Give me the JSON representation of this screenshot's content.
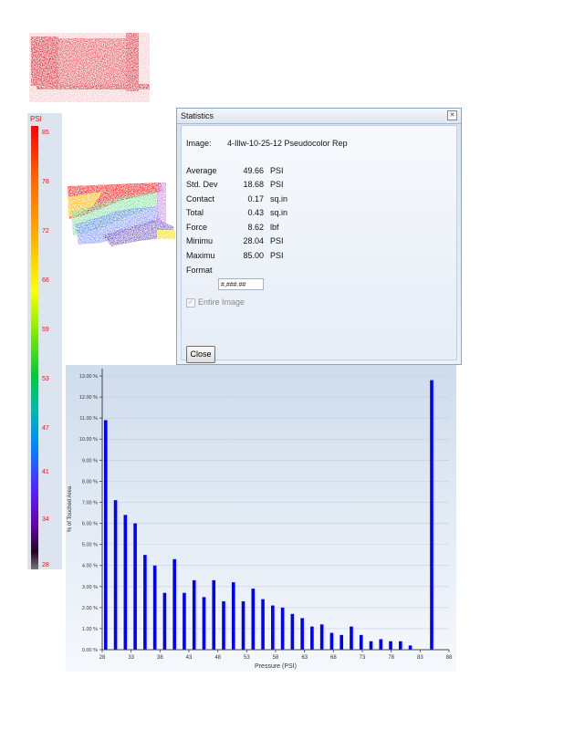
{
  "thumbnail": {
    "name": "pressure-thumbnail"
  },
  "scale": {
    "unit": "PSI",
    "ticks": [
      "85",
      "78",
      "72",
      "66",
      "59",
      "53",
      "47",
      "41",
      "34",
      "28"
    ]
  },
  "stats_window": {
    "title": "Statistics",
    "close_symbol": "✕",
    "image_label": "Image:",
    "image_name": "4-Illw-10-25-12 Pseudocolor Rep",
    "rows": [
      {
        "label": "Average",
        "value": "49.66",
        "unit": "PSI"
      },
      {
        "label": "Std. Dev",
        "value": "18.68",
        "unit": "PSI"
      },
      {
        "label": "Contact",
        "value": "0.17",
        "unit": "sq.in"
      },
      {
        "label": "Total",
        "value": "0.43",
        "unit": "sq.in"
      },
      {
        "label": "Force",
        "value": "8.62",
        "unit": "lbf"
      },
      {
        "label": "Minimu",
        "value": "28.04",
        "unit": "PSI"
      },
      {
        "label": "Maximu",
        "value": "85.00",
        "unit": "PSI"
      }
    ],
    "format_label": "Format",
    "format_value": "#,###.##",
    "entire_image_label": "Entire Image",
    "entire_image_checked": true,
    "close_button": "Close"
  },
  "chart_data": {
    "type": "bar",
    "xlabel": "Pressure (PSI)",
    "ylabel": "% of Touched Area",
    "x_ticks": [
      28,
      33,
      38,
      43,
      48,
      53,
      58,
      63,
      68,
      73,
      78,
      83,
      88
    ],
    "y_ticks": [
      "0.00 %",
      "1.00 %",
      "2.00 %",
      "3.00 %",
      "4.00 %",
      "5.00 %",
      "6.00 %",
      "7.00 %",
      "8.00 %",
      "9.00 %",
      "10.00 %",
      "11.00 %",
      "12.00 %",
      "13.00 %"
    ],
    "xlim": [
      28,
      88
    ],
    "ylim": [
      0,
      13
    ],
    "bar_color": "#0000ff",
    "x": [
      28.6,
      30.3,
      32.0,
      33.7,
      35.4,
      37.1,
      38.8,
      40.5,
      42.2,
      43.9,
      45.6,
      47.3,
      49.0,
      50.7,
      52.4,
      54.1,
      55.8,
      57.5,
      59.2,
      60.9,
      62.6,
      64.3,
      66.0,
      67.7,
      69.4,
      71.1,
      72.8,
      74.5,
      76.2,
      77.9,
      79.6,
      81.3,
      83.0,
      84.7,
      85.0
    ],
    "values": [
      10.9,
      7.1,
      6.4,
      6.0,
      4.5,
      4.0,
      2.7,
      4.3,
      2.7,
      3.3,
      2.5,
      3.3,
      2.3,
      3.2,
      2.3,
      2.9,
      2.4,
      2.1,
      2.0,
      1.7,
      1.5,
      1.1,
      1.2,
      0.8,
      0.7,
      1.1,
      0.7,
      0.4,
      0.5,
      0.4,
      0.4,
      0.2,
      12.8
    ]
  }
}
